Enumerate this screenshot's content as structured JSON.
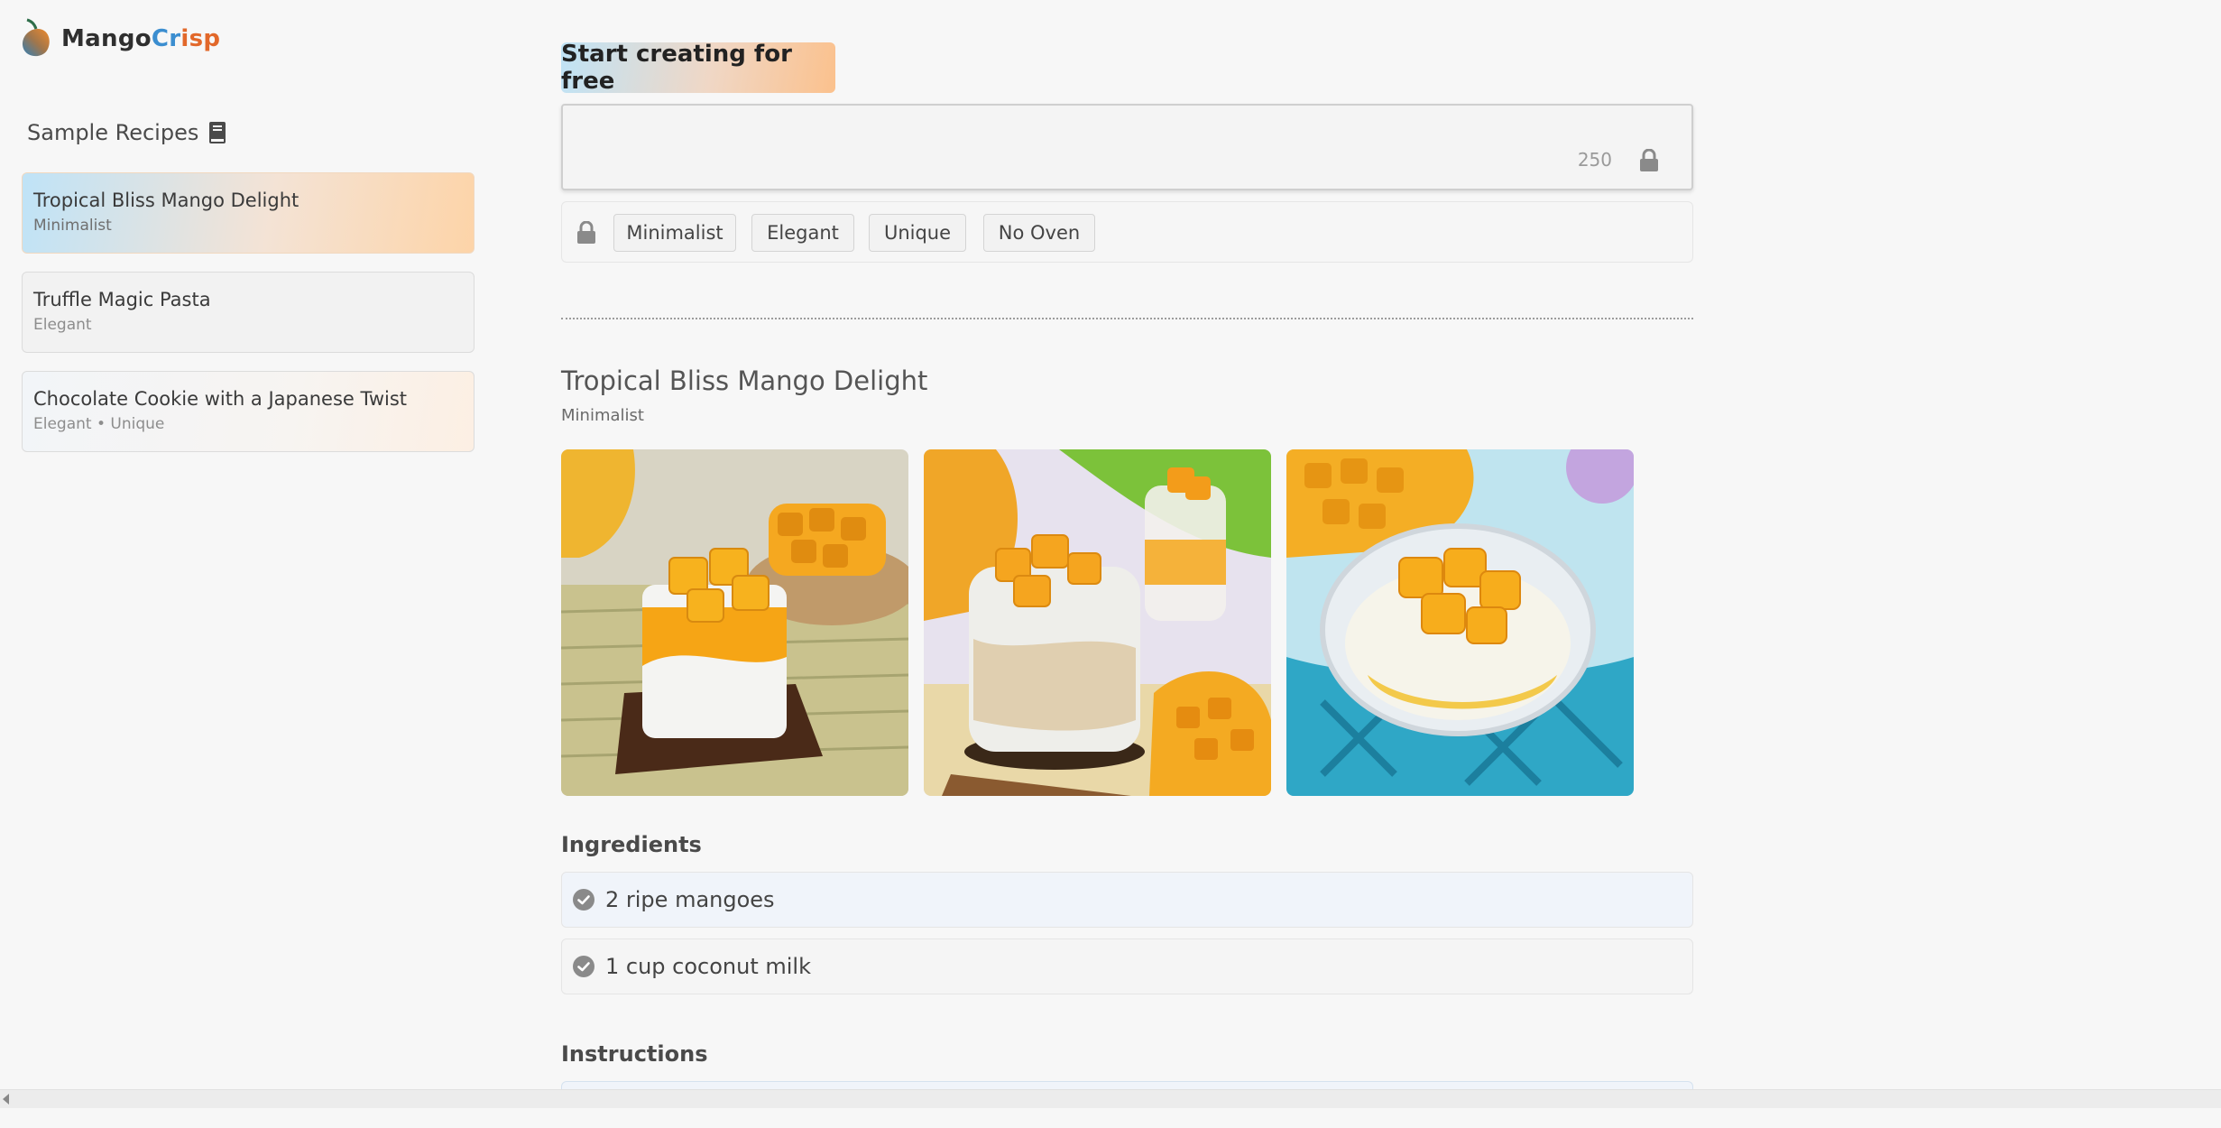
{
  "brand": {
    "part1": "Mango",
    "part2": "Cr",
    "part3": "isp"
  },
  "sidebar": {
    "title": "Sample Recipes",
    "items": [
      {
        "title": "Tropical Bliss Mango Delight",
        "tags": "Minimalist"
      },
      {
        "title": "Truffle Magic Pasta",
        "tags": "Elegant"
      },
      {
        "title": "Chocolate Cookie with a Japanese Twist",
        "tags": "Elegant • Unique"
      }
    ]
  },
  "main": {
    "cta": "Start creating for free",
    "prompt": {
      "value": "",
      "char_count": "250"
    },
    "tags": [
      "Minimalist",
      "Elegant",
      "Unique",
      "No Oven"
    ],
    "recipe": {
      "title": "Tropical Bliss Mango Delight",
      "style": "Minimalist",
      "ingredients_heading": "Ingredients",
      "ingredients": [
        "2 ripe mangoes",
        "1 cup coconut milk"
      ],
      "instructions_heading": "Instructions"
    }
  },
  "colors": {
    "brand_blue": "#3b8ed0",
    "brand_orange": "#e2682a",
    "mango": "#f6a81e"
  }
}
